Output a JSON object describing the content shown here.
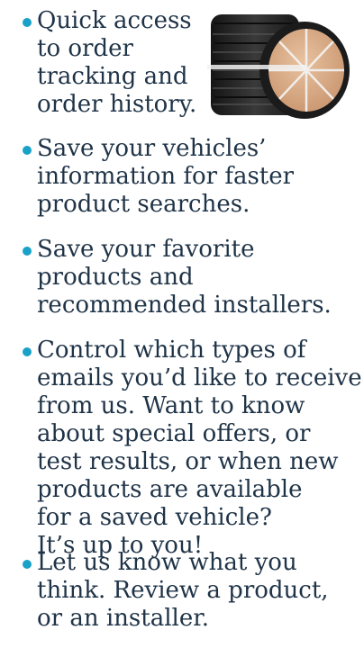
{
  "benefits": [
    {
      "text": "Quick access\nto order\ntracking and\norder history."
    },
    {
      "text": "Save your vehicles’\ninformation for faster\nproduct searches."
    },
    {
      "text": "Save your favorite\nproducts and\nrecommended installers."
    },
    {
      "text": "Control which types of\nemails you’d like to receive\nfrom us. Want to know\nabout special offers, or\ntest results, or when new\nproducts are available\nfor a saved vehicle?\nIt’s up to you!"
    },
    {
      "text": "Let us know what you\nthink. Review a product,\nor an installer."
    }
  ],
  "image": {
    "icon": "stacked-tires-image"
  },
  "colors": {
    "bullet": "#1aa1c8",
    "text": "#1f3347"
  }
}
